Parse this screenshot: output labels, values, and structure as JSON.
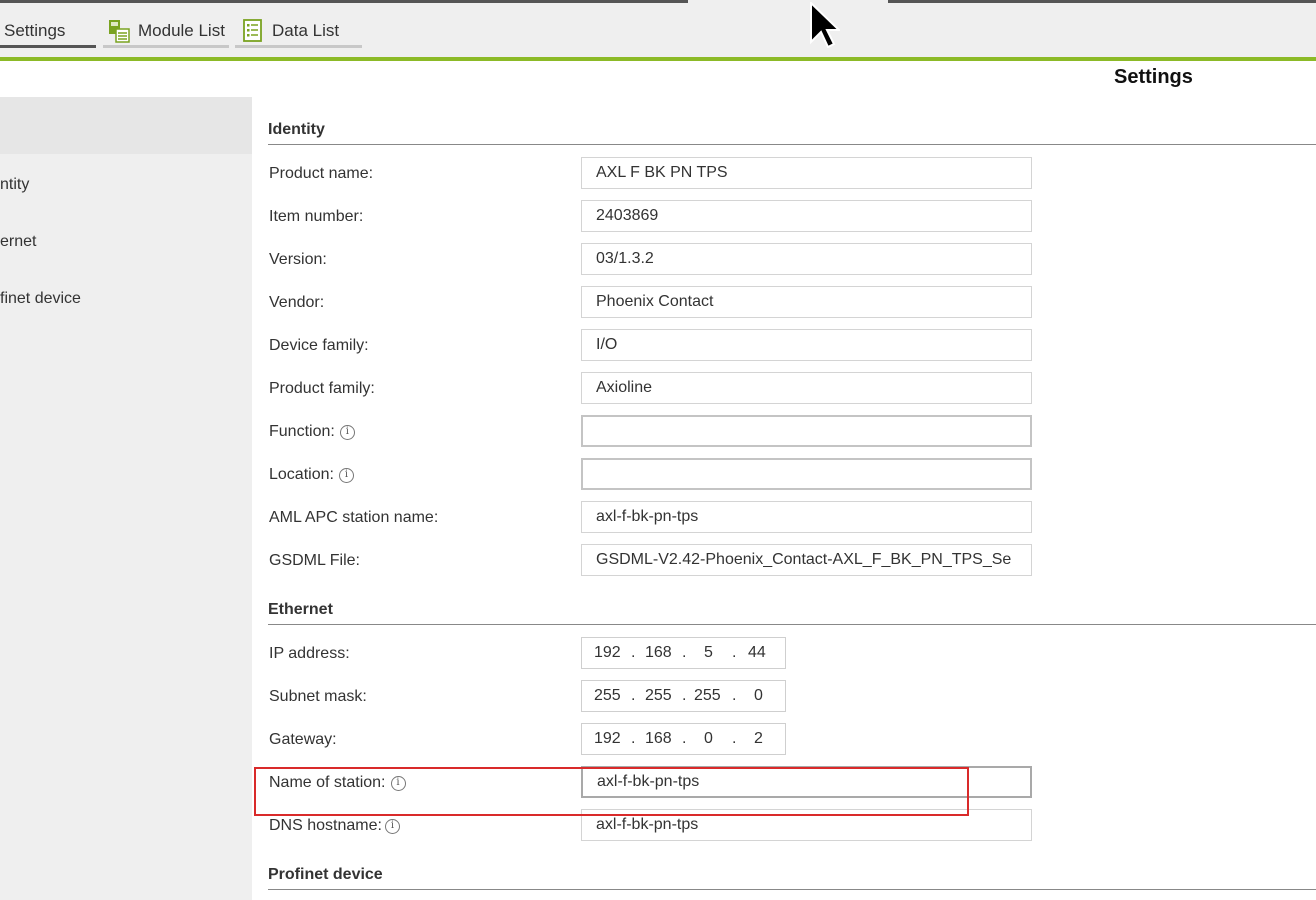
{
  "tabs": [
    {
      "label": "Settings",
      "icon": "settings-icon"
    },
    {
      "label": "Module List",
      "icon": "module-list-icon"
    },
    {
      "label": "Data List",
      "icon": "data-list-icon"
    }
  ],
  "page_title": "Settings",
  "sidebar": {
    "items": [
      {
        "label": "ntity"
      },
      {
        "label": "ernet"
      },
      {
        "label": "finet device"
      }
    ]
  },
  "identity": {
    "heading": "Identity",
    "rows": [
      {
        "label": "Product name:",
        "value": "AXL F BK PN TPS"
      },
      {
        "label": "Item number:",
        "value": "2403869"
      },
      {
        "label": "Version:",
        "value": "03/1.3.2"
      },
      {
        "label": "Vendor:",
        "value": "Phoenix Contact"
      },
      {
        "label": "Device family:",
        "value": "I/O"
      },
      {
        "label": "Product family:",
        "value": "Axioline"
      },
      {
        "label": "Function:",
        "value": ""
      },
      {
        "label": "Location:",
        "value": ""
      },
      {
        "label": "AML APC station name:",
        "value": "axl-f-bk-pn-tps"
      },
      {
        "label": "GSDML File:",
        "value": "GSDML-V2.42-Phoenix_Contact-AXL_F_BK_PN_TPS_Se"
      }
    ]
  },
  "ethernet": {
    "heading": "Ethernet",
    "ip_address": {
      "label": "IP address:",
      "octets": [
        "192",
        "168",
        "5",
        "44"
      ]
    },
    "subnet_mask": {
      "label": "Subnet mask:",
      "octets": [
        "255",
        "255",
        "255",
        "0"
      ]
    },
    "gateway": {
      "label": "Gateway:",
      "octets": [
        "192",
        "168",
        "0",
        "2"
      ]
    },
    "station_name": {
      "label": "Name of station:",
      "value": "axl-f-bk-pn-tps"
    },
    "dns_hostname": {
      "label": "DNS hostname:",
      "value": "axl-f-bk-pn-tps"
    },
    "dot": "."
  },
  "profinet": {
    "heading": "Profinet device"
  },
  "info_glyph": "i",
  "colors": {
    "accent_green": "#8cba27",
    "highlight_red": "#d92a2a"
  }
}
